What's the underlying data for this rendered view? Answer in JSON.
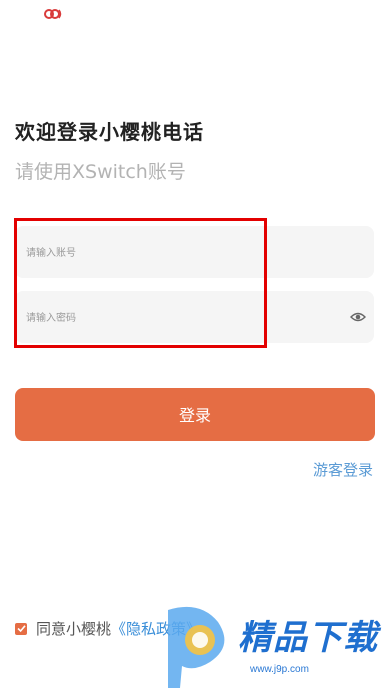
{
  "header": {
    "title": "欢迎登录小樱桃电话",
    "subtitle": "请使用XSwitch账号"
  },
  "form": {
    "account_placeholder": "请输入账号",
    "password_placeholder": "请输入密码",
    "login_label": "登录",
    "guest_label": "游客登录"
  },
  "agreement": {
    "checked": true,
    "text": "同意小樱桃",
    "policy": "《隐私政策》"
  },
  "watermark": {
    "brand": "精品下载",
    "url": "www.j9p.com"
  },
  "colors": {
    "accent": "#e56d44",
    "link": "#5b9bd5",
    "highlight": "#e30000"
  },
  "icons": [
    "app-logo-icon",
    "eye-icon",
    "checkbox-check-icon",
    "watermark-logo-icon"
  ]
}
